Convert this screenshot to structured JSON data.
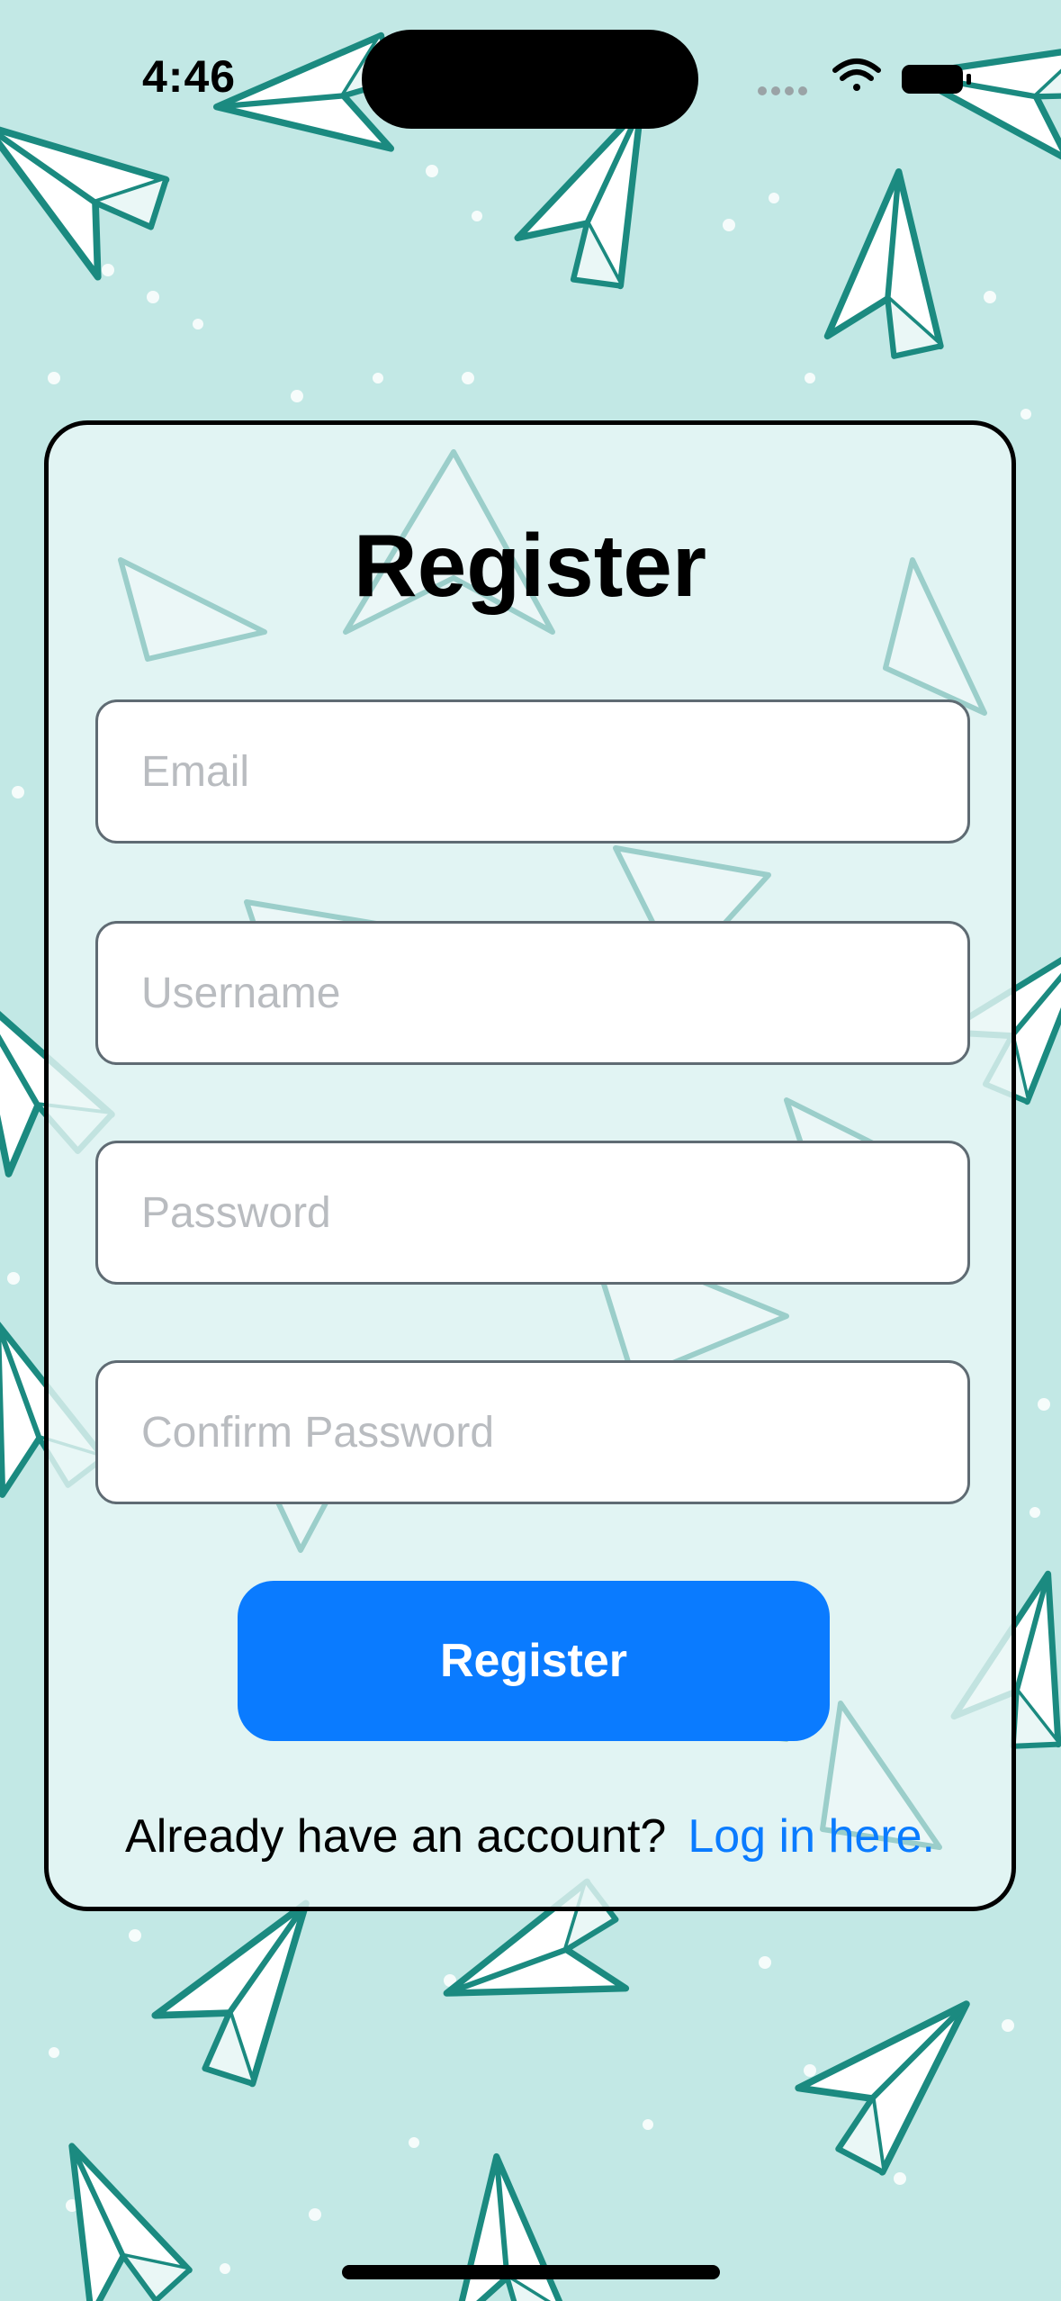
{
  "status_bar": {
    "time": "4:46",
    "icons": [
      "signal-dots-icon",
      "wifi-icon",
      "battery-icon"
    ]
  },
  "form": {
    "title": "Register",
    "fields": {
      "email": {
        "value": "",
        "placeholder": "Email"
      },
      "username": {
        "value": "",
        "placeholder": "Username"
      },
      "password": {
        "value": "",
        "placeholder": "Password"
      },
      "confirm_password": {
        "value": "",
        "placeholder": "Confirm Password"
      }
    },
    "submit_label": "Register",
    "footer_prompt": "Already have an account?",
    "footer_link": "Log in here."
  },
  "colors": {
    "background": "#c2e8e5",
    "plane_stroke": "#1b8a80",
    "accent": "#0a7bff",
    "card_border": "#000000"
  }
}
